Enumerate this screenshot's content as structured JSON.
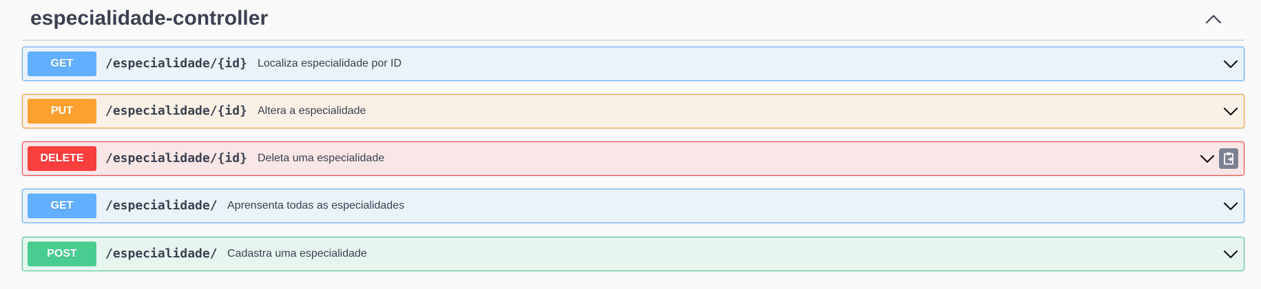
{
  "tag": {
    "title": "especialidade-controller"
  },
  "operations": [
    {
      "method": "GET",
      "path": "/especialidade/{id}",
      "summary": "Localiza especialidade por ID"
    },
    {
      "method": "PUT",
      "path": "/especialidade/{id}",
      "summary": "Altera a especialidade"
    },
    {
      "method": "DELETE",
      "path": "/especialidade/{id}",
      "summary": "Deleta uma especialidade"
    },
    {
      "method": "GET",
      "path": "/especialidade/",
      "summary": "Aprensenta todas as especialidades"
    },
    {
      "method": "POST",
      "path": "/especialidade/",
      "summary": "Cadastra uma especialidade"
    }
  ],
  "icons": {
    "tag_toggle": "chevron-up-icon",
    "expand": "chevron-down-icon",
    "copy": "clipboard-copy-icon"
  },
  "colors": {
    "get": "#61affe",
    "put": "#fca130",
    "delete": "#f93e3e",
    "post": "#49cc90",
    "text": "#3b4151"
  }
}
